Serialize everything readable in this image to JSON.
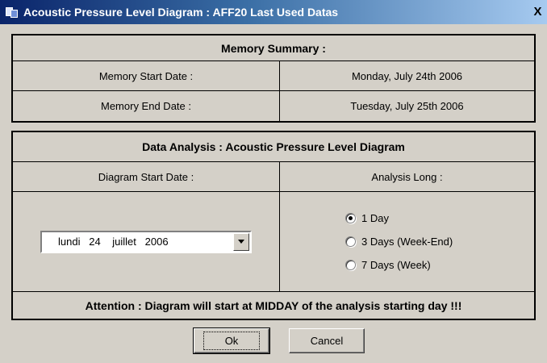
{
  "window": {
    "title": "Acoustic Pressure Level Diagram : AFF20 Last Used Datas",
    "close_label": "X"
  },
  "summary": {
    "header": "Memory Summary :",
    "start_label": "Memory Start Date :",
    "start_value": "Monday, July 24th 2006",
    "end_label": "Memory End Date :",
    "end_value": "Tuesday, July 25th 2006"
  },
  "analysis": {
    "header": "Data Analysis : Acoustic Pressure Level Diagram",
    "start_label": "Diagram Start Date :",
    "long_label": "Analysis Long :",
    "date_value": "lundi   24    juillet   2006",
    "options": [
      {
        "label": "1 Day",
        "checked": true
      },
      {
        "label": "3 Days (Week-End)",
        "checked": false
      },
      {
        "label": "7 Days (Week)",
        "checked": false
      }
    ],
    "warning": "Attention : Diagram will start at MIDDAY of the analysis starting day !!!"
  },
  "buttons": {
    "ok": "Ok",
    "cancel": "Cancel"
  },
  "icons": {
    "app": "app-window-icon",
    "dropdown": "chevron-down-icon"
  }
}
